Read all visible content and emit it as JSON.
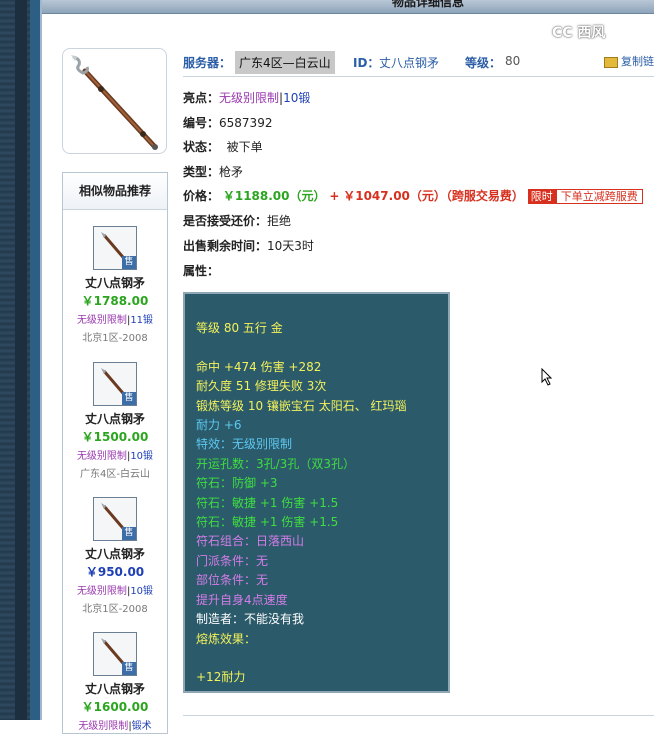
{
  "window": {
    "title": "物品详细信息"
  },
  "watermark": "CC 西风",
  "header": {
    "server_label": "服务器：",
    "server_value": "广东4区—白云山",
    "id_label": "ID：",
    "id_value": "丈八点钢矛",
    "level_label": "等级：",
    "level_value": "80",
    "copy_label": "复制链"
  },
  "details": {
    "highlight_label": "亮点：",
    "highlight_tag": "无级别限制",
    "highlight_sep": "|",
    "highlight_forge": "10锻",
    "number_label": "编号：",
    "number_value": "6587392",
    "status_label": "状态：",
    "status_value": "被下单",
    "type_label": "类型：",
    "type_value": "枪矛",
    "price_label": "价格：",
    "price_value": "￥1188.00（元）",
    "price_plus": "+",
    "fee_value": "￥1047.00（元）（跨服交易费）",
    "limit_badge": "限时",
    "limit_text": "下单立减跨服费",
    "counter_label": "是否接受还价：",
    "counter_value": "拒绝",
    "remaining_label": "出售剩余时间：",
    "remaining_value": "10天3时",
    "attr_label": "属性："
  },
  "attributes": {
    "line1": "等级 80 五行 金",
    "line2": "命中 +474 伤害 +282",
    "line3": "耐久度 51 修理失败 3次",
    "line4": "锻炼等级 10 镶嵌宝石 太阳石、 红玛瑙",
    "line5": "耐力 +6",
    "line6": "特效：无级别限制",
    "line7": "开运孔数：3孔/3孔（双3孔）",
    "line8": "符石：防御 +3",
    "line9": "符石：敏捷 +1 伤害 +1.5",
    "line10": "符石：敏捷 +1 伤害 +1.5",
    "line11": "符石组合：日落西山",
    "line12": "门派条件：无",
    "line13": "部位条件：无",
    "line14": "提升自身4点速度",
    "line15": "制造者：不能没有我",
    "line16": "熔炼效果：",
    "line17": "+12耐力"
  },
  "similar": {
    "title": "相似物品推荐",
    "sell_badge": "售",
    "items": [
      {
        "name": "丈八点钢矛",
        "price": "￥1788.00",
        "tag": "无级别限制",
        "sep": "|",
        "forge": "11锻",
        "server": "北京1区-2008"
      },
      {
        "name": "丈八点钢矛",
        "price": "￥1500.00",
        "tag": "无级别限制",
        "sep": "|",
        "forge": "10锻",
        "server": "广东4区-白云山"
      },
      {
        "name": "丈八点钢矛",
        "price": "￥950.00",
        "tag": "无级别限制",
        "sep": "|",
        "forge": "10锻",
        "server": "北京1区-2008"
      },
      {
        "name": "丈八点钢矛",
        "price": "￥1600.00",
        "tag": "无级别限制",
        "sep": "|",
        "forge": "锻术",
        "server": ""
      }
    ]
  },
  "colors": {
    "panel_bg": "#2b5a6b",
    "label_blue": "#2b5ea7",
    "price_green": "#2ba51f",
    "fee_red": "#d7301f",
    "tag_purple": "#9b39b0"
  }
}
